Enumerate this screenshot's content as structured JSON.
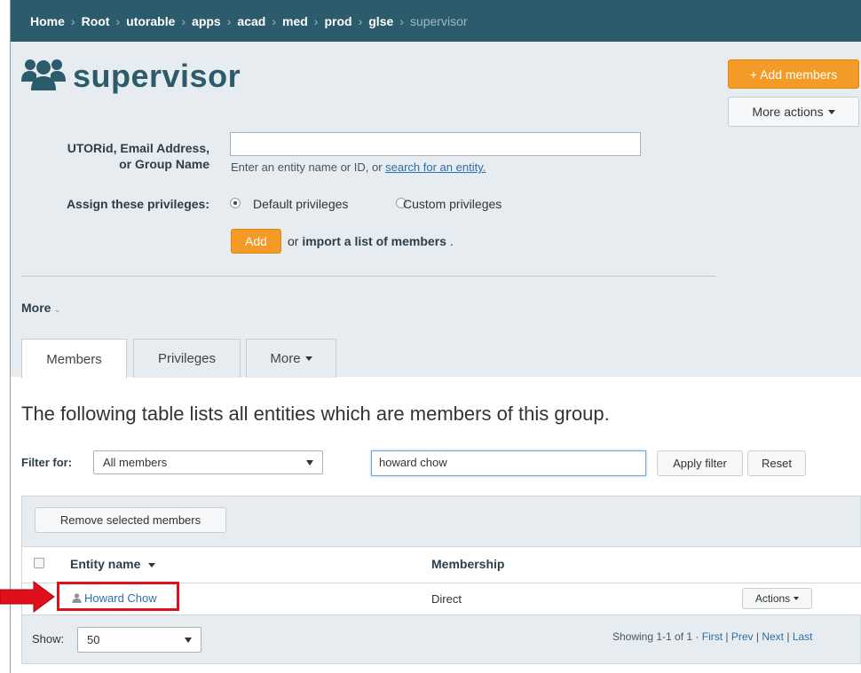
{
  "breadcrumb": {
    "items": [
      "Home",
      "Root",
      "utorable",
      "apps",
      "acad",
      "med",
      "prod",
      "glse"
    ],
    "current": "supervisor",
    "separator": "›"
  },
  "page": {
    "title": "supervisor",
    "icon": "users-group-icon"
  },
  "header_actions": {
    "add_members": "+ Add members",
    "more_actions": "More actions"
  },
  "add_form": {
    "utorid_label_line1": "UTORid, Email Address,",
    "utorid_label_line2": "or Group Name",
    "entity_input_value": "",
    "hint_prefix": "Enter an entity name or ID, or ",
    "hint_link": "search for an entity.",
    "assign_label": "Assign these privileges:",
    "radio_default": "Default privileges",
    "radio_custom": "Custom privileges",
    "selected_privilege": "Default privileges",
    "add_button": "Add",
    "import_prefix": "or ",
    "import_link": "import a list of members",
    "import_suffix": " ."
  },
  "more_toggle": "More",
  "tabs": [
    {
      "label": "Members",
      "active": true
    },
    {
      "label": "Privileges",
      "active": false
    },
    {
      "label": "More",
      "active": false
    }
  ],
  "members": {
    "intro": "The following table lists all entities which are members of this group.",
    "filter_label": "Filter for:",
    "filter_select": "All members",
    "filter_input_value": "howard chow",
    "apply_filter": "Apply filter",
    "reset": "Reset",
    "remove_selected": "Remove selected members",
    "columns": {
      "entity": "Entity name",
      "membership": "Membership"
    },
    "rows": [
      {
        "entity": "Howard Chow",
        "membership": "Direct",
        "actions": "Actions"
      }
    ],
    "show_label": "Show:",
    "show_value": "50",
    "pagination_summary": "Showing 1-1 of 1 · ",
    "pagination_links": [
      "First",
      "Prev",
      "Next",
      "Last"
    ]
  },
  "colors": {
    "breadcrumb_bg": "#2c5c6c",
    "title": "#2c5c6c",
    "accent_orange": "#f49a26",
    "panel_bg": "#e6ecf0",
    "link": "#2f6fa8",
    "highlight": "#e0101a"
  }
}
